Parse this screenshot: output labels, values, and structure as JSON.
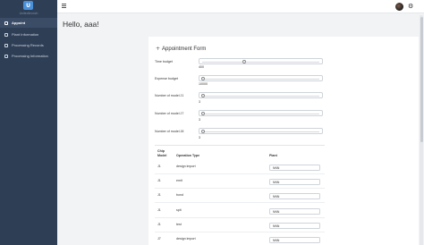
{
  "sidebar": {
    "logo_text": "U",
    "brand": "Unitedbrunch",
    "items": [
      {
        "label": "Appoint",
        "active": true
      },
      {
        "label": "Plant Information",
        "active": false
      },
      {
        "label": "Processing Records",
        "active": false
      },
      {
        "label": "Processing Information",
        "active": false
      }
    ]
  },
  "header": {
    "greeting": "Hello, aaa!"
  },
  "form": {
    "title": "Appointment Form",
    "fields": [
      {
        "label": "Time budget",
        "value": "400",
        "fraction": 0.35
      },
      {
        "label": "Expense budget",
        "value": "10000",
        "fraction": 0.0
      },
      {
        "label": "Number of model J1",
        "value": "3",
        "fraction": 0.0
      },
      {
        "label": "Number of model J7",
        "value": "3",
        "fraction": 0.0
      },
      {
        "label": "Number of model J8",
        "value": "3",
        "fraction": 0.0
      }
    ]
  },
  "table": {
    "headers": {
      "chip_model": "Chip Model",
      "operation_type": "Operation Type",
      "plant": "Plant"
    },
    "rows": [
      {
        "chip": "J1",
        "op": "design import",
        "plant": "NNN"
      },
      {
        "chip": "J1",
        "op": "emit",
        "plant": "NNN"
      },
      {
        "chip": "J1",
        "op": "bond",
        "plant": "NNN"
      },
      {
        "chip": "J1",
        "op": "spit",
        "plant": "NNN"
      },
      {
        "chip": "J1",
        "op": "test",
        "plant": "NNN"
      },
      {
        "chip": "J7",
        "op": "design import",
        "plant": "NNN"
      }
    ]
  },
  "icons": {
    "menu": "hamburger-icon",
    "settings": "gear-icon",
    "plus": "plus-icon"
  }
}
